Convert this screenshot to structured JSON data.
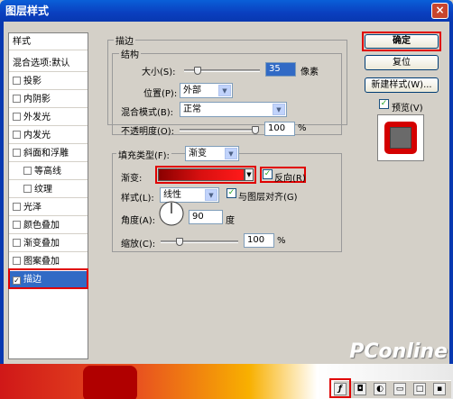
{
  "window": {
    "title": "图层样式",
    "close_glyph": "×"
  },
  "left_panel": {
    "header": "样式",
    "blend_options": "混合选项:默认",
    "items": [
      {
        "label": "投影",
        "checked": false
      },
      {
        "label": "内阴影",
        "checked": false
      },
      {
        "label": "外发光",
        "checked": false
      },
      {
        "label": "内发光",
        "checked": false
      },
      {
        "label": "斜面和浮雕",
        "checked": false
      },
      {
        "label": "等高线",
        "checked": false
      },
      {
        "label": "纹理",
        "checked": false
      },
      {
        "label": "光泽",
        "checked": false
      },
      {
        "label": "颜色叠加",
        "checked": false
      },
      {
        "label": "渐变叠加",
        "checked": false
      },
      {
        "label": "图案叠加",
        "checked": false
      },
      {
        "label": "描边",
        "checked": true
      }
    ]
  },
  "stroke": {
    "section_title": "描边",
    "structure_title": "结构",
    "size_label": "大小(S):",
    "size_value": "35",
    "size_unit": "像素",
    "size_level": 0.14,
    "position_label": "位置(P):",
    "position_value": "外部",
    "blend_label": "混合模式(B):",
    "blend_value": "正常",
    "opacity_label": "不透明度(O):",
    "opacity_value": "100",
    "opacity_unit": "%",
    "opacity_level": 1.0,
    "fill_type_label": "填充类型(F):",
    "fill_type_value": "渐变",
    "gradient_label": "渐变:",
    "reverse_label": "反向(R)",
    "reverse_checked": true,
    "style_label": "样式(L):",
    "style_value": "线性",
    "align_label": "与图层对齐(G)",
    "align_checked": true,
    "angle_label": "角度(A):",
    "angle_value": "90",
    "angle_unit": "度",
    "scale_label": "缩放(C):",
    "scale_value": "100",
    "scale_unit": "%",
    "scale_level": 0.22,
    "gradient_colors": [
      "#8a0000",
      "#d91010",
      "#ff1a1a"
    ]
  },
  "buttons": {
    "ok": "确定",
    "reset": "复位",
    "new_style": "新建样式(W)...",
    "preview_label": "预览(V)",
    "preview_checked": true
  },
  "colors": {
    "highlight_red": "#e00000",
    "selection": "#316ac5",
    "preview_ring": "#d40000",
    "preview_core": "#6a6a6a"
  },
  "watermark": "PConline",
  "taskbar_icons": [
    "fx-icon",
    "mask-icon",
    "adjust-icon",
    "folder-icon",
    "new-layer-icon",
    "trash-icon"
  ]
}
